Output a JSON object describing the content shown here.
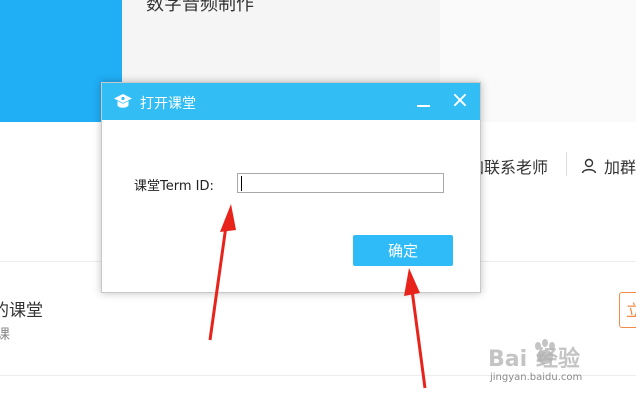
{
  "background": {
    "course_title": "数字音频制作",
    "contact_teacher": "加联系老师",
    "group_link": "加群",
    "my_class": "的课堂",
    "my_class_sub": "课",
    "right_button": "立"
  },
  "dialog": {
    "title": "打开课堂",
    "field_label": "课堂Term ID:",
    "input_value": "",
    "confirm_label": "确定"
  },
  "colors": {
    "accent_blue": "#33bdf5",
    "button_blue": "#2ebbf7",
    "annotation_red": "#e8231c"
  },
  "icons": {
    "app": "graduation-cap-icon",
    "minimize": "minimize-icon",
    "close": "close-icon",
    "user": "user-icon"
  },
  "watermark": {
    "brand": "Baidu经验",
    "domain": "jingyan.baidu.com"
  }
}
